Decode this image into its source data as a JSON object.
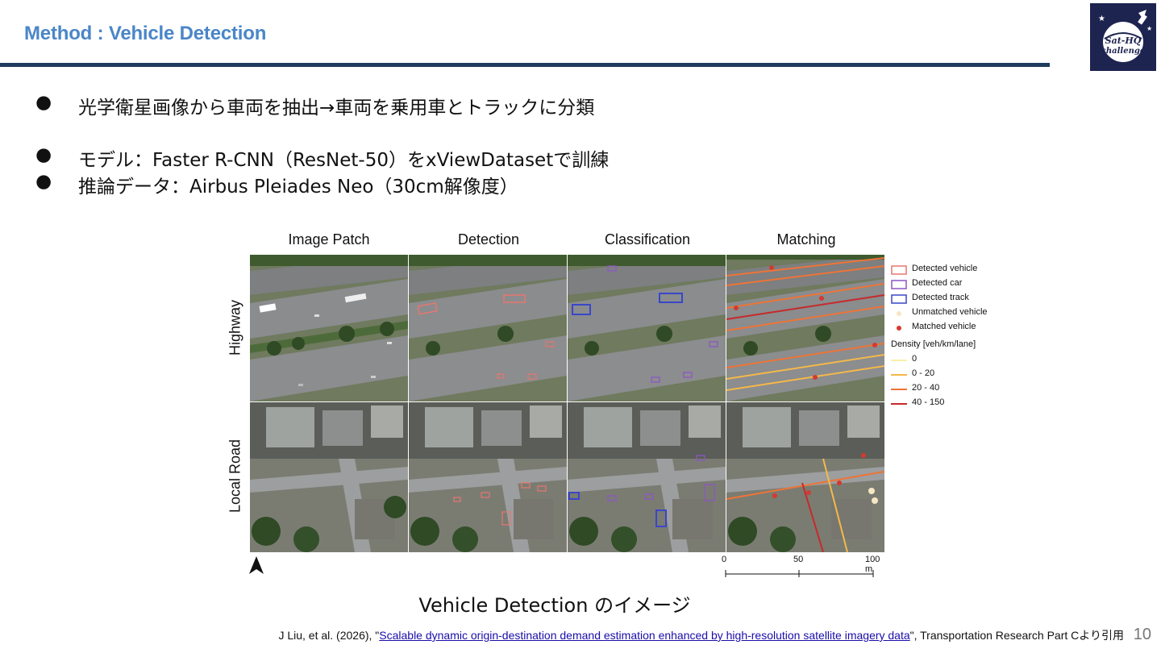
{
  "header": {
    "title": "Method : Vehicle Detection"
  },
  "logo": {
    "text_line1": "Sat-HQ",
    "text_line2": "challenge"
  },
  "bullets": [
    {
      "dot": "●",
      "text": "光学衛星画像から車両を抽出→車両を乗用車とトラックに分類"
    },
    {
      "dot": "●",
      "text": "モデル：Faster R-CNN（ResNet-50）をxViewDatasetで訓練"
    },
    {
      "dot": "●",
      "text": "推論データ：Airbus Pleiades Neo（30cm解像度）"
    }
  ],
  "figure": {
    "column_headers": [
      "Image Patch",
      "Detection",
      "Classification",
      "Matching"
    ],
    "row_labels": [
      "Highway",
      "Local Road"
    ],
    "legend": {
      "items": [
        {
          "label": "Detected vehicle",
          "color": "#e8766f",
          "kind": "box"
        },
        {
          "label": "Detected car",
          "color": "#8e56c4",
          "kind": "box"
        },
        {
          "label": "Detected track",
          "color": "#3a46c8",
          "kind": "box"
        },
        {
          "label": "Unmatched vehicle",
          "color": "#f6e7c4",
          "kind": "dot"
        },
        {
          "label": "Matched vehicle",
          "color": "#d43a2f",
          "kind": "dot"
        }
      ],
      "density_title": "Density [veh/km/lane]",
      "density": [
        {
          "label": "0",
          "color": "#f8f0a8"
        },
        {
          "label": "0 - 20",
          "color": "#f5b84a"
        },
        {
          "label": "20 - 40",
          "color": "#ee7437"
        },
        {
          "label": "40 - 150",
          "color": "#c62a2a"
        }
      ]
    },
    "scale_bar": {
      "ticks": [
        "0",
        "50",
        "100 m"
      ]
    }
  },
  "caption": "Vehicle Detection のイメージ",
  "citation": {
    "prefix": "J Liu, et al. (2026), \"",
    "link_text": "Scalable dynamic origin-destination demand estimation enhanced by high-resolution satellite imagery data",
    "suffix": "\", Transportation Research Part Cより引用"
  },
  "page_number": "10"
}
